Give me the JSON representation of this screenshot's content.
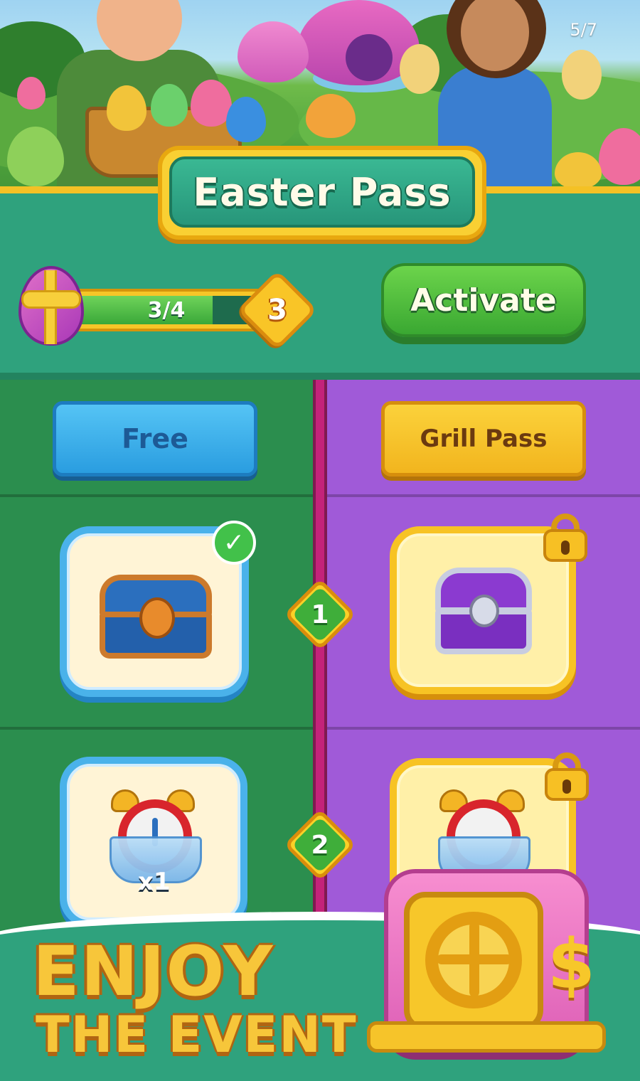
{
  "page_counter": "5/7",
  "title": "Easter Pass",
  "progress": {
    "text": "3/4",
    "fraction": 0.75,
    "level": "3"
  },
  "activate_label": "Activate",
  "columns": {
    "free_label": "Free",
    "premium_label": "Grill Pass"
  },
  "rows": [
    {
      "step": "1",
      "free_reward": "chest-icon",
      "free_claimed": true,
      "premium_reward": "purple-chest-icon",
      "premium_locked": true
    },
    {
      "step": "2",
      "free_reward": "alarm-clock-icon",
      "free_quantity": "x1",
      "premium_reward": "alarm-clock-icon",
      "premium_locked": true
    }
  ],
  "banner": {
    "line1": "ENJOY",
    "line2": "THE EVENT"
  },
  "colors": {
    "teal": "#2fa27d",
    "free_column": "#2b8e4e",
    "grill_column": "#a05ad8",
    "gold": "#f7c63a"
  }
}
